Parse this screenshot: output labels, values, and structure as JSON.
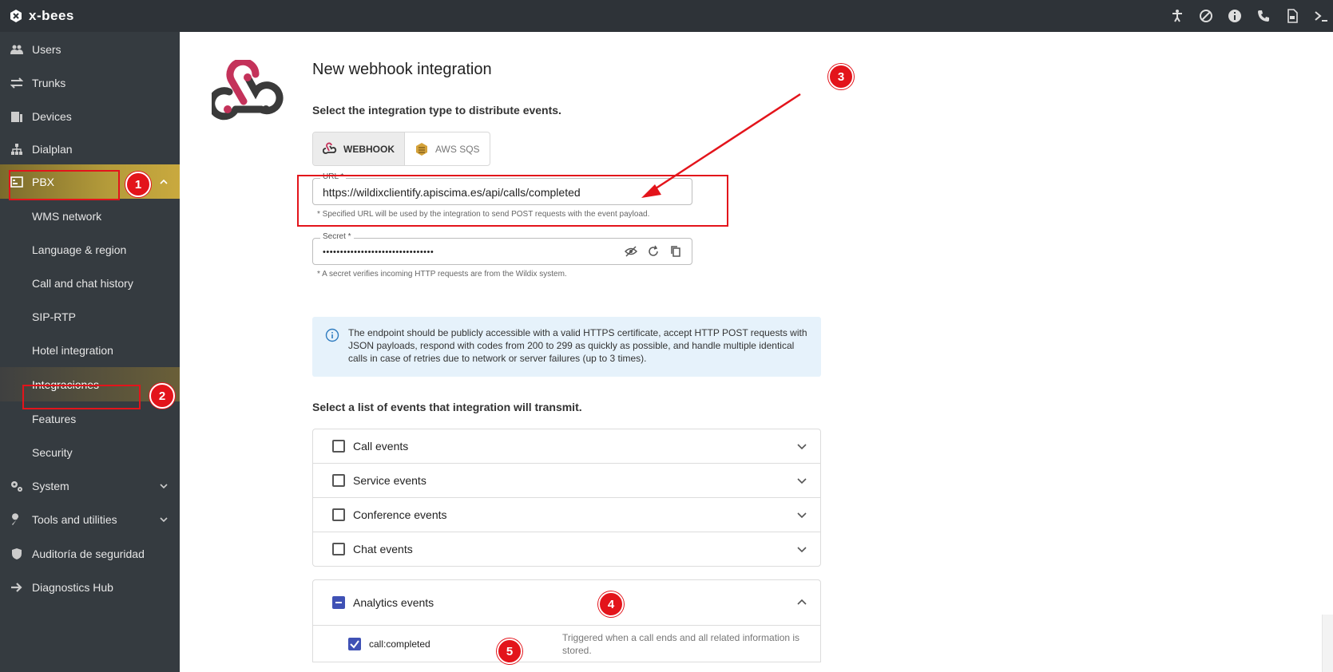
{
  "app": {
    "brand": "x-bees"
  },
  "sidebar": {
    "items": [
      {
        "label": "Users",
        "icon": "users-icon"
      },
      {
        "label": "Trunks",
        "icon": "arrows-exchange-icon"
      },
      {
        "label": "Devices",
        "icon": "devices-icon"
      },
      {
        "label": "Dialplan",
        "icon": "sitemap-icon"
      },
      {
        "label": "PBX",
        "icon": "pbx-icon"
      },
      {
        "label": "WMS network"
      },
      {
        "label": "Language & region"
      },
      {
        "label": "Call and chat history"
      },
      {
        "label": "SIP-RTP"
      },
      {
        "label": "Hotel integration"
      },
      {
        "label": "Integraciones"
      },
      {
        "label": "Features"
      },
      {
        "label": "Security"
      },
      {
        "label": "System",
        "icon": "gears-icon"
      },
      {
        "label": "Tools and utilities",
        "icon": "wrench-icon"
      },
      {
        "label": "Auditoría de seguridad",
        "icon": "shield-icon"
      },
      {
        "label": "Diagnostics Hub",
        "icon": "arrow-right-icon"
      }
    ]
  },
  "main": {
    "title": "New webhook integration",
    "type_prompt": "Select the integration type to distribute events.",
    "types": [
      {
        "label": "WEBHOOK",
        "icon": "webhook-icon",
        "selected": true
      },
      {
        "label": "AWS SQS",
        "icon": "aws-sqs-icon",
        "selected": false
      }
    ],
    "url": {
      "label": "URL *",
      "value": "https://wildixclientify.apiscima.es/api/calls/completed",
      "hint": "* Specified URL will be used by the integration to send POST requests with the event payload."
    },
    "secret": {
      "label": "Secret *",
      "value": "••••••••••••••••••••••••••••••••",
      "hint": "* A secret verifies incoming HTTP requests are from the Wildix system."
    },
    "info": "The endpoint should be publicly accessible with a valid HTTPS certificate, accept HTTP POST requests with JSON payloads, respond with codes from 200 to 299 as quickly as possible, and handle multiple identical calls in case of retries due to network or server failures (up to 3 times).",
    "events_prompt": "Select a list of events that integration will transmit.",
    "events": [
      {
        "label": "Call events",
        "state": "unchecked",
        "expanded": false
      },
      {
        "label": "Service events",
        "state": "unchecked",
        "expanded": false
      },
      {
        "label": "Conference events",
        "state": "unchecked",
        "expanded": false
      },
      {
        "label": "Chat events",
        "state": "unchecked",
        "expanded": false
      },
      {
        "label": "Analytics events",
        "state": "indeterminate",
        "expanded": true
      }
    ],
    "analytics_items": [
      {
        "label": "call:completed",
        "checked": true,
        "description": "Triggered when a call ends and all related information is stored."
      }
    ]
  },
  "annotations": {
    "badges": [
      "1",
      "2",
      "3",
      "4",
      "5"
    ],
    "color": "#e3141b"
  }
}
